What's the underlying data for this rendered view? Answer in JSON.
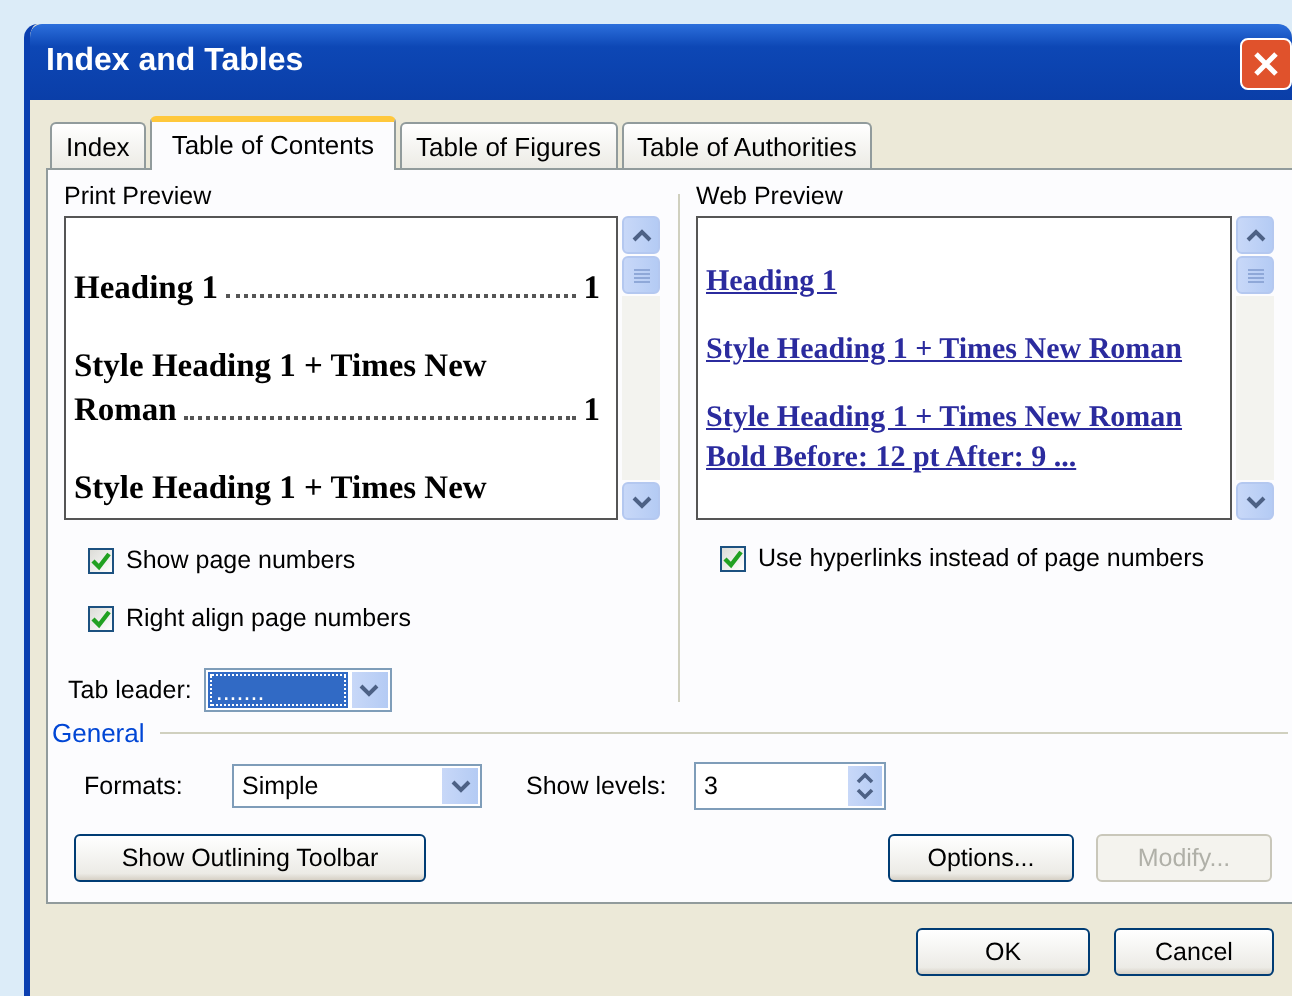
{
  "window": {
    "title": "Index and Tables"
  },
  "tabs": [
    {
      "label": "Index",
      "selected": false
    },
    {
      "label": "Table of Contents",
      "selected": true
    },
    {
      "label": "Table of Figures",
      "selected": false
    },
    {
      "label": "Table of Authorities",
      "selected": false
    }
  ],
  "print_preview": {
    "label": "Print Preview",
    "entries": [
      {
        "lines": [
          "Heading 1"
        ],
        "page": "1"
      },
      {
        "lines": [
          "Style Heading 1 + Times New",
          "Roman"
        ],
        "page": "1"
      },
      {
        "lines": [
          "Style Heading 1 + Times New"
        ]
      }
    ]
  },
  "web_preview": {
    "label": "Web Preview",
    "entries": [
      {
        "lines": [
          "Heading 1"
        ]
      },
      {
        "lines": [
          "Style Heading 1 + Times New Roman"
        ]
      },
      {
        "lines": [
          "Style Heading 1 + Times New Roman",
          "Bold Before:  12 pt After:  9 ..."
        ]
      }
    ]
  },
  "print_options": [
    {
      "label": "Show page numbers",
      "checked": true
    },
    {
      "label": "Right align page numbers",
      "checked": true
    }
  ],
  "tab_leader": {
    "label": "Tab leader:",
    "value": "......."
  },
  "web_options": [
    {
      "label": "Use hyperlinks instead of page numbers",
      "checked": true
    }
  ],
  "general": {
    "title": "General",
    "formats_label": "Formats:",
    "formats_value": "Simple",
    "levels_label": "Show levels:",
    "levels_value": "3"
  },
  "panel_buttons": [
    {
      "label": "Show Outlining Toolbar",
      "disabled": false
    },
    {
      "label": "Options...",
      "disabled": false
    },
    {
      "label": "Modify...",
      "disabled": true
    }
  ],
  "dialog_buttons": [
    {
      "label": "OK"
    },
    {
      "label": "Cancel"
    }
  ]
}
